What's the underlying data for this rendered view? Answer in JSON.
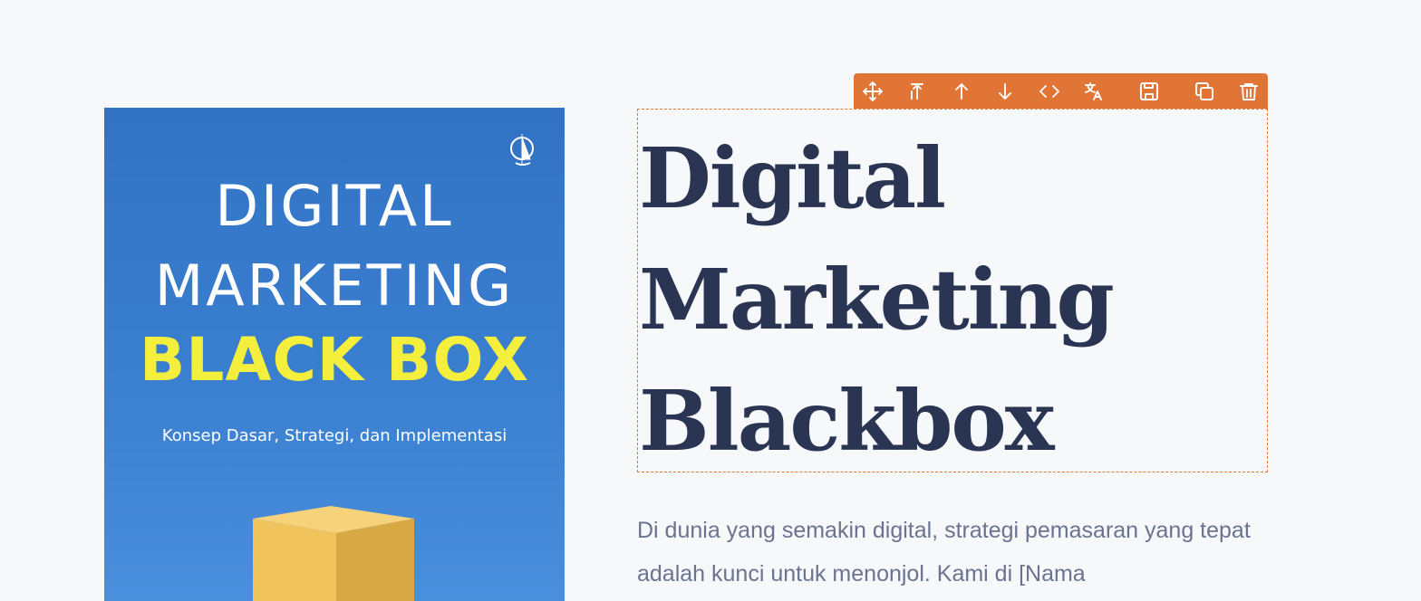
{
  "book_cover": {
    "line1": "DIGITAL",
    "line2": "MARKETING",
    "line3": "BLACK BOX",
    "subtitle": "Konsep Dasar, Strategi, dan Implementasi",
    "colors": {
      "background": "#3272c4",
      "accent": "#f4ee3c"
    }
  },
  "toolbar": {
    "buttons": [
      {
        "icon": "move-icon"
      },
      {
        "icon": "select-parent-icon"
      },
      {
        "icon": "move-up-icon"
      },
      {
        "icon": "move-down-icon"
      },
      {
        "icon": "code-icon"
      },
      {
        "icon": "translate-icon"
      },
      {
        "icon": "save-icon"
      },
      {
        "icon": "duplicate-icon"
      },
      {
        "icon": "delete-icon"
      }
    ],
    "color": "#e07536"
  },
  "heading": {
    "line1": "Digital",
    "line2": "Marketing",
    "line3": "Blackbox"
  },
  "body": {
    "text": "Di dunia yang semakin digital, strategi pemasaran yang tepat adalah kunci untuk menonjol. Kami di [Nama"
  }
}
